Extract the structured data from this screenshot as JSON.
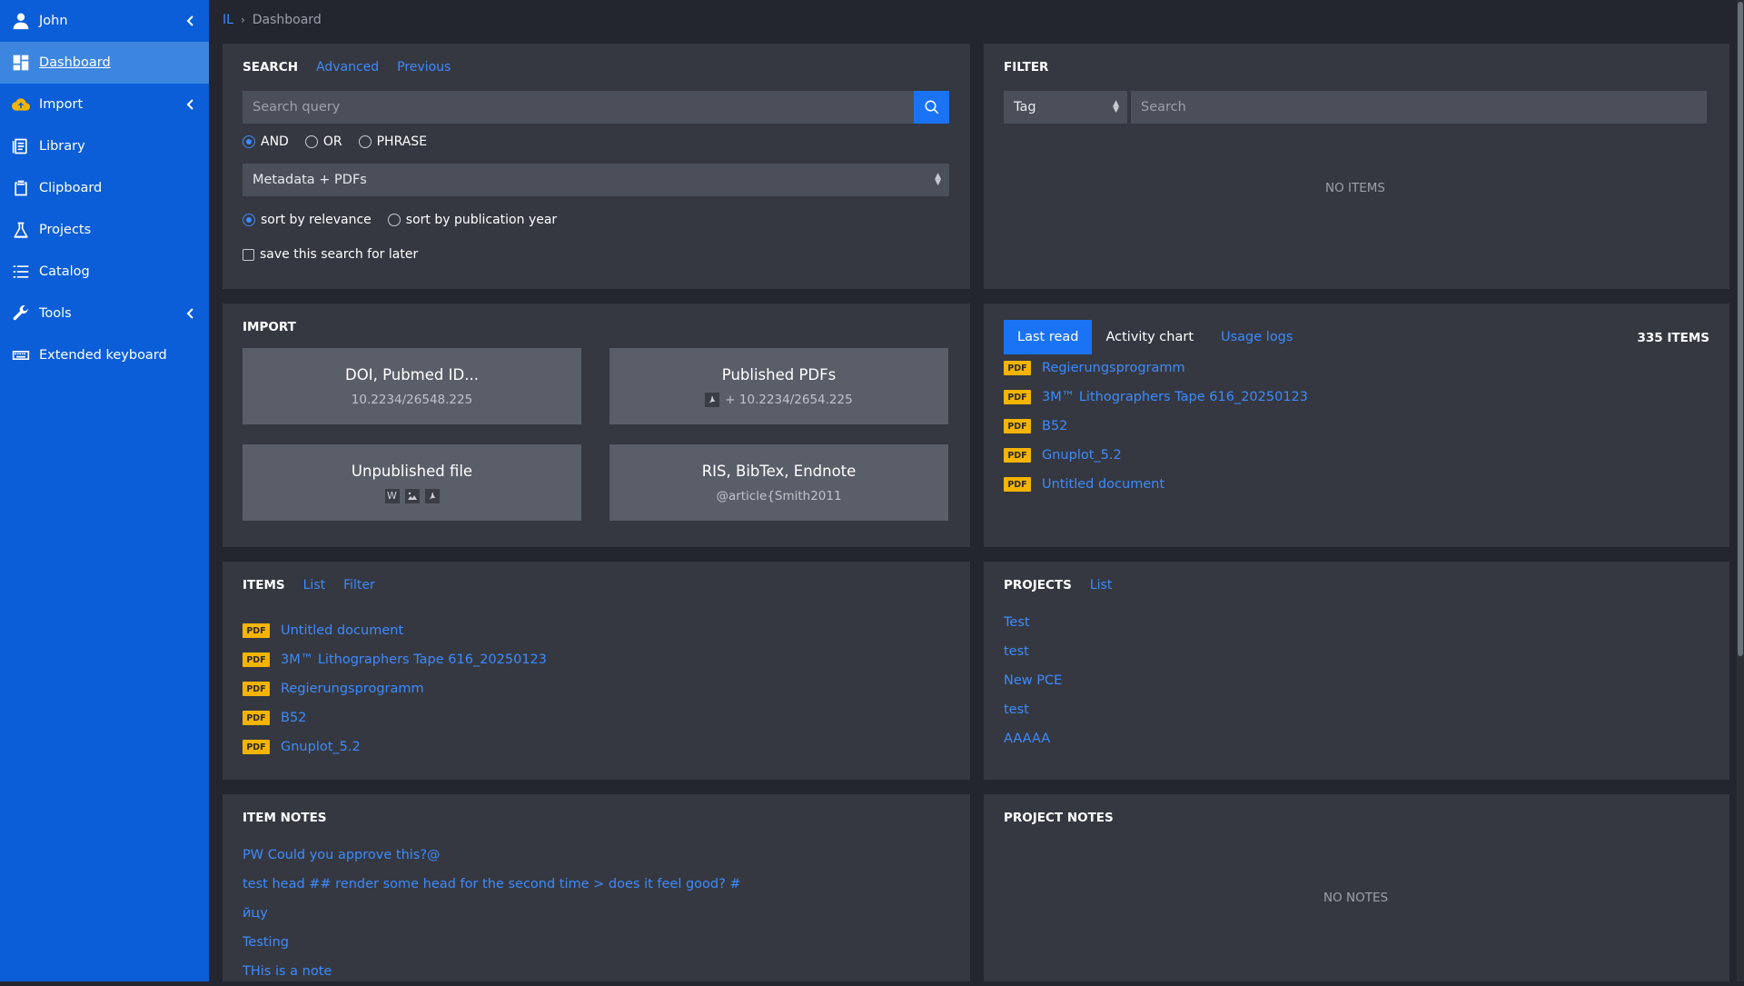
{
  "sidebar": {
    "user": "John",
    "items": [
      {
        "label": "Dashboard",
        "icon": "dashboard-icon",
        "active": true
      },
      {
        "label": "Import",
        "icon": "cloud-upload-icon",
        "chevron": true
      },
      {
        "label": "Library",
        "icon": "library-icon"
      },
      {
        "label": "Clipboard",
        "icon": "clipboard-icon"
      },
      {
        "label": "Projects",
        "icon": "flask-icon"
      },
      {
        "label": "Catalog",
        "icon": "list-icon"
      },
      {
        "label": "Tools",
        "icon": "wrench-icon",
        "chevron": true
      },
      {
        "label": "Extended keyboard",
        "icon": "keyboard-icon"
      }
    ]
  },
  "breadcrumb": {
    "root": "IL",
    "current": "Dashboard"
  },
  "search": {
    "title": "SEARCH",
    "advanced": "Advanced",
    "previous": "Previous",
    "placeholder": "Search query",
    "operators": [
      "AND",
      "OR",
      "PHRASE"
    ],
    "operator_selected": "AND",
    "scope": "Metadata + PDFs",
    "sort_options": [
      "sort by relevance",
      "sort by publication year"
    ],
    "sort_selected": "sort by relevance",
    "save_label": "save this search for later"
  },
  "filter": {
    "title": "FILTER",
    "type": "Tag",
    "placeholder": "Search",
    "empty": "NO ITEMS"
  },
  "import": {
    "title": "IMPORT",
    "tiles": [
      {
        "title": "DOI, Pubmed ID...",
        "sub": "10.2234/26548.225"
      },
      {
        "title": "Published PDFs",
        "sub": "+ 10.2234/2654.225"
      },
      {
        "title": "Unpublished file",
        "sub": ""
      },
      {
        "title": "RIS, BibTex, Endnote",
        "sub": "@article{Smith2011"
      }
    ],
    "word_icon": "W"
  },
  "recent": {
    "tabs": [
      "Last read",
      "Activity chart",
      "Usage logs"
    ],
    "count": "335 ITEMS",
    "badge": "PDF",
    "items": [
      "Regierungsprogramm",
      "3M™ Lithographers Tape 616_20250123",
      "B52",
      "Gnuplot_5.2",
      "Untitled document"
    ]
  },
  "items": {
    "title": "ITEMS",
    "links": [
      "List",
      "Filter"
    ],
    "badge": "PDF",
    "list": [
      "Untitled document",
      "3M™ Lithographers Tape 616_20250123",
      "Regierungsprogramm",
      "B52",
      "Gnuplot_5.2"
    ]
  },
  "projects": {
    "title": "PROJECTS",
    "link": "List",
    "list": [
      "Test",
      "test",
      "New PCE",
      "test",
      "AAAAA"
    ]
  },
  "item_notes": {
    "title": "ITEM NOTES",
    "list": [
      "PW Could you approve this?@",
      "test head ## render some head for the second time > does it feel good? #",
      "йцу",
      "Testing",
      "THis is a note"
    ]
  },
  "project_notes": {
    "title": "PROJECT NOTES",
    "empty": "NO NOTES"
  },
  "colors": {
    "sidebar": "#0b5ed7",
    "accent": "#1a73f5",
    "link": "#3d8bfd",
    "pdf_badge": "#f4b400",
    "panel": "#353841",
    "background": "#23262e"
  }
}
